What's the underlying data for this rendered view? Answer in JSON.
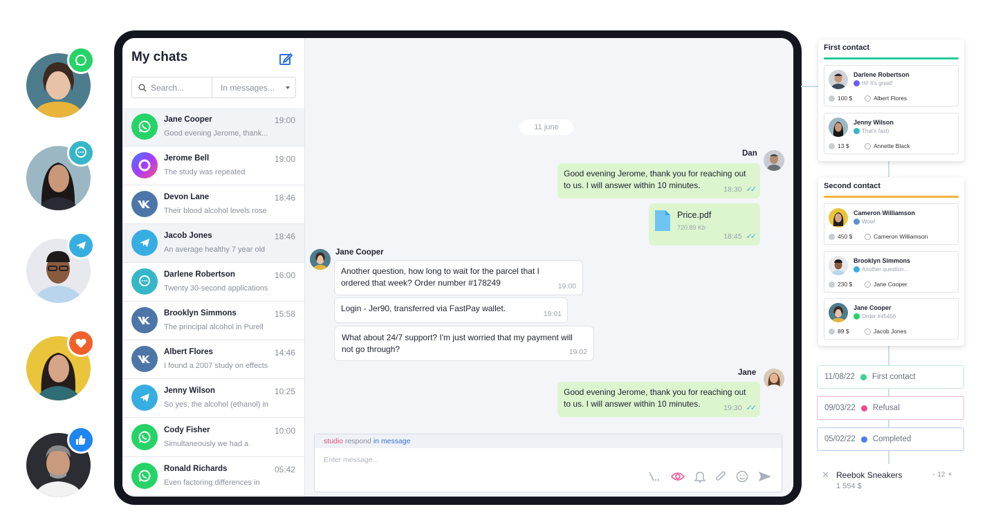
{
  "side_badges": [
    {
      "icon": "whatsapp-icon",
      "color": "#25d366"
    },
    {
      "icon": "chat-bubble-icon",
      "color": "#36b6c9"
    },
    {
      "icon": "telegram-icon",
      "color": "#37aee2"
    },
    {
      "icon": "heart-icon",
      "color": "#f0602a"
    },
    {
      "icon": "thumbs-up-icon",
      "color": "#1f85f0"
    }
  ],
  "chatlist": {
    "title": "My chats",
    "search_placeholder": "Search...",
    "scope": "In messages...",
    "chats": [
      {
        "name": "Jane Cooper",
        "time": "19:00",
        "preview": "Good evening Jerome, thank...",
        "channel": "whatsapp"
      },
      {
        "name": "Jerome Bell",
        "time": "19:00",
        "preview": "The study was repeated",
        "channel": "messenger"
      },
      {
        "name": "Devon Lane",
        "time": "18:46",
        "preview": "Their blood alcohol levels rose",
        "channel": "vk"
      },
      {
        "name": "Jacob Jones",
        "time": "18:46",
        "preview": "An average healthy 7 year old",
        "channel": "telegram"
      },
      {
        "name": "Darlene Robertson",
        "time": "16:00",
        "preview": "Twenty 30-second applications",
        "channel": "chat"
      },
      {
        "name": "Brooklyn Simmons",
        "time": "15:58",
        "preview": "The principal alcohol in Purell",
        "channel": "vk"
      },
      {
        "name": "Albert Flores",
        "time": "14:46",
        "preview": "I found a 2007 study on effects",
        "channel": "vk"
      },
      {
        "name": "Jenny Wilson",
        "time": "10:25",
        "preview": "So yes, the alcohol (ethanol) in",
        "channel": "telegram"
      },
      {
        "name": "Cody Fisher",
        "time": "10:00",
        "preview": "Simultaneously we had a",
        "channel": "whatsapp"
      },
      {
        "name": "Ronald Richards",
        "time": "05:42",
        "preview": "Even factoring differences in",
        "channel": "whatsapp"
      }
    ]
  },
  "conversation": {
    "date": "11 june",
    "sender_dan": "Dan",
    "msg1": {
      "line1": "Good evening Jerome, thank you for reaching out",
      "line2": "to us. I will answer within 10 minutes.",
      "time": "18:30"
    },
    "file": {
      "name": "Price.pdf",
      "size": "720.89 Kb",
      "time": "18:45"
    },
    "sender_jane_cooper": "Jane Cooper",
    "msg2": {
      "line1": "Another question, how long to wait for the parcel that I",
      "line2": "ordered that week? Order number #178249",
      "time": "19:00"
    },
    "msg3": {
      "line1": "Login - Jer90, transferred via FastPay wallet.",
      "time": "19:01"
    },
    "msg4": {
      "line1": "What about 24/7 support? I'm just worried that my payment will",
      "line2": "not go through?",
      "time": "19:02"
    },
    "sender_jane": "Jane",
    "msg5": {
      "line1": "Good evening Jerome, thank you for reaching out",
      "line2": "to us. I will answer within 10 minutes.",
      "time": "19:30"
    }
  },
  "composer": {
    "hint_studio": "studio",
    "hint_respond": "respond",
    "hint_in": "in",
    "hint_message": "message",
    "placeholder": "Enter message..."
  },
  "crm": {
    "first": {
      "title": "First contact",
      "accent": "#25c99a",
      "contacts": [
        {
          "name": "Darlene Robertson",
          "msg": "Hi! It's great!",
          "amount": "100 $",
          "manager": "Albert Flores",
          "dot": "#6a5cff"
        },
        {
          "name": "Jenny Wilson",
          "msg": "That's fast)",
          "amount": "13 $",
          "manager": "Annette Black",
          "dot": "#36b6c9"
        }
      ]
    },
    "second": {
      "title": "Second contact",
      "accent": "#f2b23a",
      "contacts": [
        {
          "name": "Cameron Williamson",
          "msg": "Wow!",
          "amount": "450 $",
          "manager": "Cameron Williamson",
          "dot": "#5d8fd6"
        },
        {
          "name": "Brooklyn Simmons",
          "msg": "Another question...",
          "amount": "230 $",
          "manager": "Jane Cooper",
          "dot": "#37aee2"
        },
        {
          "name": "Jane Cooper",
          "msg": "Order #45456",
          "amount": "89 $",
          "manager": "Jacob Jones",
          "dot": "#25d366"
        }
      ]
    },
    "statuses": [
      {
        "date": "11/08/22",
        "label": "First contact",
        "color": "#3ccf8e",
        "border": "#bfe9d5"
      },
      {
        "date": "09/03/22",
        "label": "Refusal",
        "color": "#ef4b8e",
        "border": "#f3b6cc"
      },
      {
        "date": "05/02/22",
        "label": "Completed",
        "color": "#4a7ef0",
        "border": "#b7c9f0"
      }
    ],
    "product": {
      "name": "Reebok Sneakers",
      "price": "1 554 $",
      "qty_minus": "-",
      "qty": "12",
      "qty_plus": "+"
    }
  }
}
